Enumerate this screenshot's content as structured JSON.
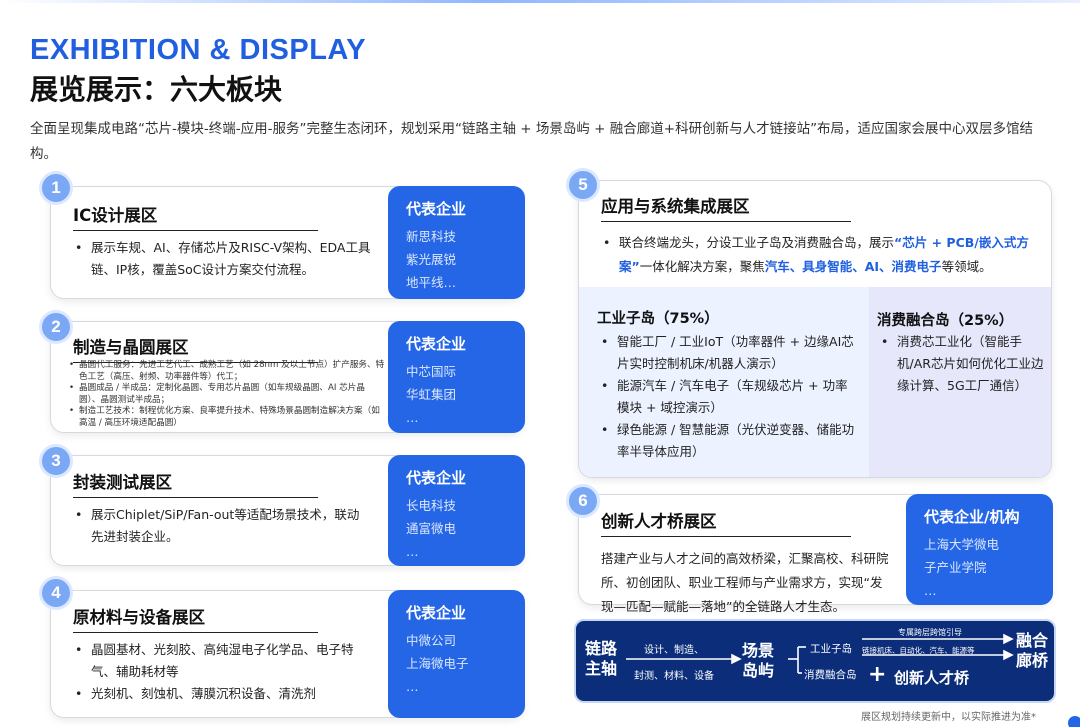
{
  "header": {
    "title_en": "EXHIBITION & DISPLAY",
    "title_cn": "展览展示：六大板块",
    "intro": "全面呈现集成电路“芯片-模块-终端-应用-服务”完整生态闭环，规划采用“链路主轴 + 场景岛屿 + 融合廊道+科研创新与人才链接站”布局，适应国家会展中心双层多馆结构。"
  },
  "panels": {
    "p1": {
      "num": "1",
      "title": "IC设计展区",
      "items": [
        "展示车规、AI、存储芯片及RISC-V架构、EDA工具链、IP核，覆盖SoC设计方案交付流程。"
      ],
      "side_title": "代表企业",
      "side_items": [
        "新思科技",
        "紫光展锐",
        "地平线…"
      ]
    },
    "p2": {
      "num": "2",
      "title": "制造与晶圆展区",
      "items": [
        "晶圆代工服务：先进工艺代工、成熟工艺（如 28nm 及以上节点）扩产服务、特色工艺（高压、射频、功率器件等）代工；",
        "晶圆成品 / 半成品：定制化晶圆、专用芯片晶圆（如车规级晶圆、AI 芯片晶圆）、晶圆测试半成品；",
        "制造工艺技术：制程优化方案、良率提升技术、特殊场景晶圆制造解决方案（如高温 / 高压环境适配晶圆）"
      ],
      "side_title": "代表企业",
      "side_items": [
        "中芯国际",
        "华虹集团",
        "…"
      ]
    },
    "p3": {
      "num": "3",
      "title": "封装测试展区",
      "items": [
        "展示Chiplet/SiP/Fan-out等适配场景技术，联动先进封装企业。"
      ],
      "side_title": "代表企业",
      "side_items": [
        "长电科技",
        "通富微电",
        "…"
      ]
    },
    "p4": {
      "num": "4",
      "title": "原材料与设备展区",
      "items": [
        "晶圆基材、光刻胶、高纯湿电子化学品、电子特气、辅助耗材等",
        "光刻机、刻蚀机、薄膜沉积设备、清洗剂"
      ],
      "side_title": "代表企业",
      "side_items": [
        "中微公司",
        "上海微电子",
        "…"
      ]
    },
    "p5": {
      "num": "5",
      "title": "应用与系统集成展区",
      "text_a": "联合终端龙头，分设工业子岛及消费融合岛，展示",
      "text_hl1": "“芯片 + PCB/嵌入式方案”",
      "text_b": "一体化解决方案，聚焦",
      "text_hl2": "汽车、具身智能、AI、消费电子",
      "text_c": "等领域。",
      "left_title": "工业子岛（75%）",
      "left_items": [
        "智能工厂 / 工业IoT（功率器件 + 边缘AI芯片实时控制机床/机器人演示）",
        "能源汽车 / 汽车电子（车规级芯片 + 功率模块 + 域控演示）",
        "绿色能源 / 智慧能源（光伏逆变器、储能功率半导体应用）"
      ],
      "right_title": "消费融合岛（25%）",
      "right_items": [
        "消费芯工业化（智能手机/AR芯片如何优化工业边缘计算、5G工厂通信）"
      ]
    },
    "p6": {
      "num": "6",
      "title": "创新人才桥展区",
      "text": "搭建产业与人才之间的高效桥梁，汇聚高校、科研院所、初创团队、职业工程师与产业需求方，实现“发现—匹配—赋能—落地”的全链路人才生态。",
      "side_title": "代表企业/机构",
      "side_items": [
        "上海大学微电",
        "子产业学院",
        "…"
      ]
    }
  },
  "diagram": {
    "axis_label_1": "链路",
    "axis_label_2": "主轴",
    "flow_top": "设计、制造、",
    "flow_bottom": "封测、材料、设备",
    "island_1": "场景",
    "island_2": "岛屿",
    "sub_top": "工业子岛",
    "sub_bottom": "消费融合岛",
    "corridor_caption": "专属跨层跨馆引导",
    "corridor_sub": "链接机床、自动化、汽车、能源等",
    "fusion_1": "融合",
    "fusion_2": "廊桥",
    "plus": "+",
    "talent": "创新人才桥"
  },
  "footnote": "展区规划持续更新中，以实际推进为准*",
  "colors": {
    "brand_blue": "#1f5fe0",
    "side_blue": "#2466e6",
    "diagram_navy": "#0b2d7a"
  }
}
